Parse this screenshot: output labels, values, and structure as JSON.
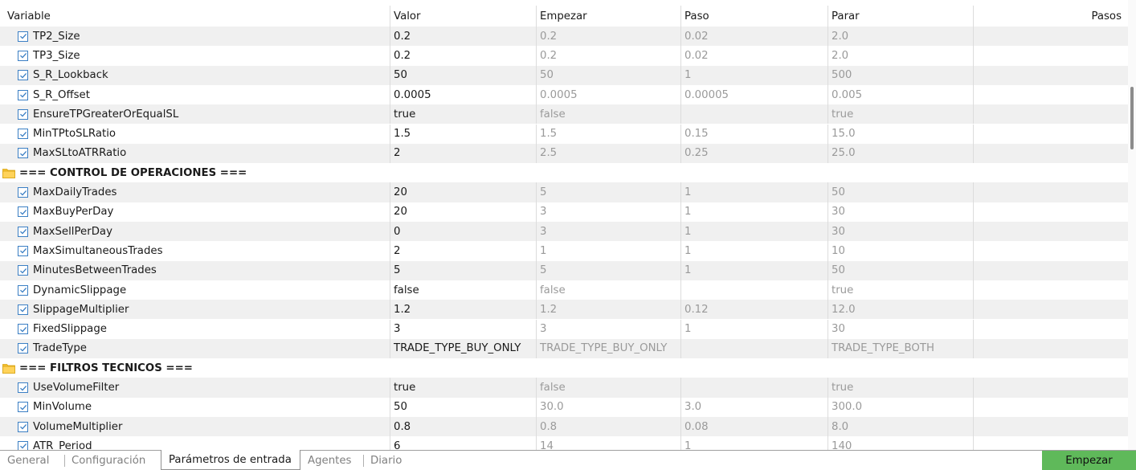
{
  "colors": {
    "row_gray": "#f0f0f0",
    "check_blue": "#3b7fc4",
    "folder_yellow": "#f5c12e",
    "start_button": "#5fb95a"
  },
  "header": {
    "variable": "Variable",
    "value": "Valor",
    "start": "Empezar",
    "step": "Paso",
    "stop": "Parar",
    "steps": "Pasos"
  },
  "rows": [
    {
      "type": "param",
      "name": "TP2_Size",
      "value": "0.2",
      "start": "0.2",
      "step": "0.02",
      "stop": "2.0"
    },
    {
      "type": "param",
      "name": "TP3_Size",
      "value": "0.2",
      "start": "0.2",
      "step": "0.02",
      "stop": "2.0"
    },
    {
      "type": "param",
      "name": "S_R_Lookback",
      "value": "50",
      "start": "50",
      "step": "1",
      "stop": "500"
    },
    {
      "type": "param",
      "name": "S_R_Offset",
      "value": "0.0005",
      "start": "0.0005",
      "step": "0.00005",
      "stop": "0.005"
    },
    {
      "type": "param",
      "name": "EnsureTPGreaterOrEqualSL",
      "value": "true",
      "start": "false",
      "step": "",
      "stop": "true"
    },
    {
      "type": "param",
      "name": "MinTPtoSLRatio",
      "value": "1.5",
      "start": "1.5",
      "step": "0.15",
      "stop": "15.0"
    },
    {
      "type": "param",
      "name": "MaxSLtoATRRatio",
      "value": "2",
      "start": "2.5",
      "step": "0.25",
      "stop": "25.0"
    },
    {
      "type": "group",
      "name": "=== CONTROL DE OPERACIONES ==="
    },
    {
      "type": "param",
      "name": "MaxDailyTrades",
      "value": "20",
      "start": "5",
      "step": "1",
      "stop": "50"
    },
    {
      "type": "param",
      "name": "MaxBuyPerDay",
      "value": "20",
      "start": "3",
      "step": "1",
      "stop": "30"
    },
    {
      "type": "param",
      "name": "MaxSellPerDay",
      "value": "0",
      "start": "3",
      "step": "1",
      "stop": "30"
    },
    {
      "type": "param",
      "name": "MaxSimultaneousTrades",
      "value": "2",
      "start": "1",
      "step": "1",
      "stop": "10"
    },
    {
      "type": "param",
      "name": "MinutesBetweenTrades",
      "value": "5",
      "start": "5",
      "step": "1",
      "stop": "50"
    },
    {
      "type": "param",
      "name": "DynamicSlippage",
      "value": "false",
      "start": "false",
      "step": "",
      "stop": "true"
    },
    {
      "type": "param",
      "name": "SlippageMultiplier",
      "value": "1.2",
      "start": "1.2",
      "step": "0.12",
      "stop": "12.0"
    },
    {
      "type": "param",
      "name": "FixedSlippage",
      "value": "3",
      "start": "3",
      "step": "1",
      "stop": "30"
    },
    {
      "type": "param",
      "name": "TradeType",
      "value": "TRADE_TYPE_BUY_ONLY",
      "start": "TRADE_TYPE_BUY_ONLY",
      "step": "",
      "stop": "TRADE_TYPE_BOTH"
    },
    {
      "type": "group",
      "name": "=== FILTROS TECNICOS ==="
    },
    {
      "type": "param",
      "name": "UseVolumeFilter",
      "value": "true",
      "start": "false",
      "step": "",
      "stop": "true"
    },
    {
      "type": "param",
      "name": "MinVolume",
      "value": "50",
      "start": "30.0",
      "step": "3.0",
      "stop": "300.0"
    },
    {
      "type": "param",
      "name": "VolumeMultiplier",
      "value": "0.8",
      "start": "0.8",
      "step": "0.08",
      "stop": "8.0"
    },
    {
      "type": "param",
      "name": "ATR_Period",
      "value": "6",
      "start": "14",
      "step": "1",
      "stop": "140"
    }
  ],
  "tabs": [
    {
      "label": "General",
      "active": false
    },
    {
      "label": "Configuración",
      "active": false
    },
    {
      "label": "Parámetros de entrada",
      "active": true
    },
    {
      "label": "Agentes",
      "active": false
    },
    {
      "label": "Diario",
      "active": false
    }
  ],
  "start_button": "Empezar"
}
